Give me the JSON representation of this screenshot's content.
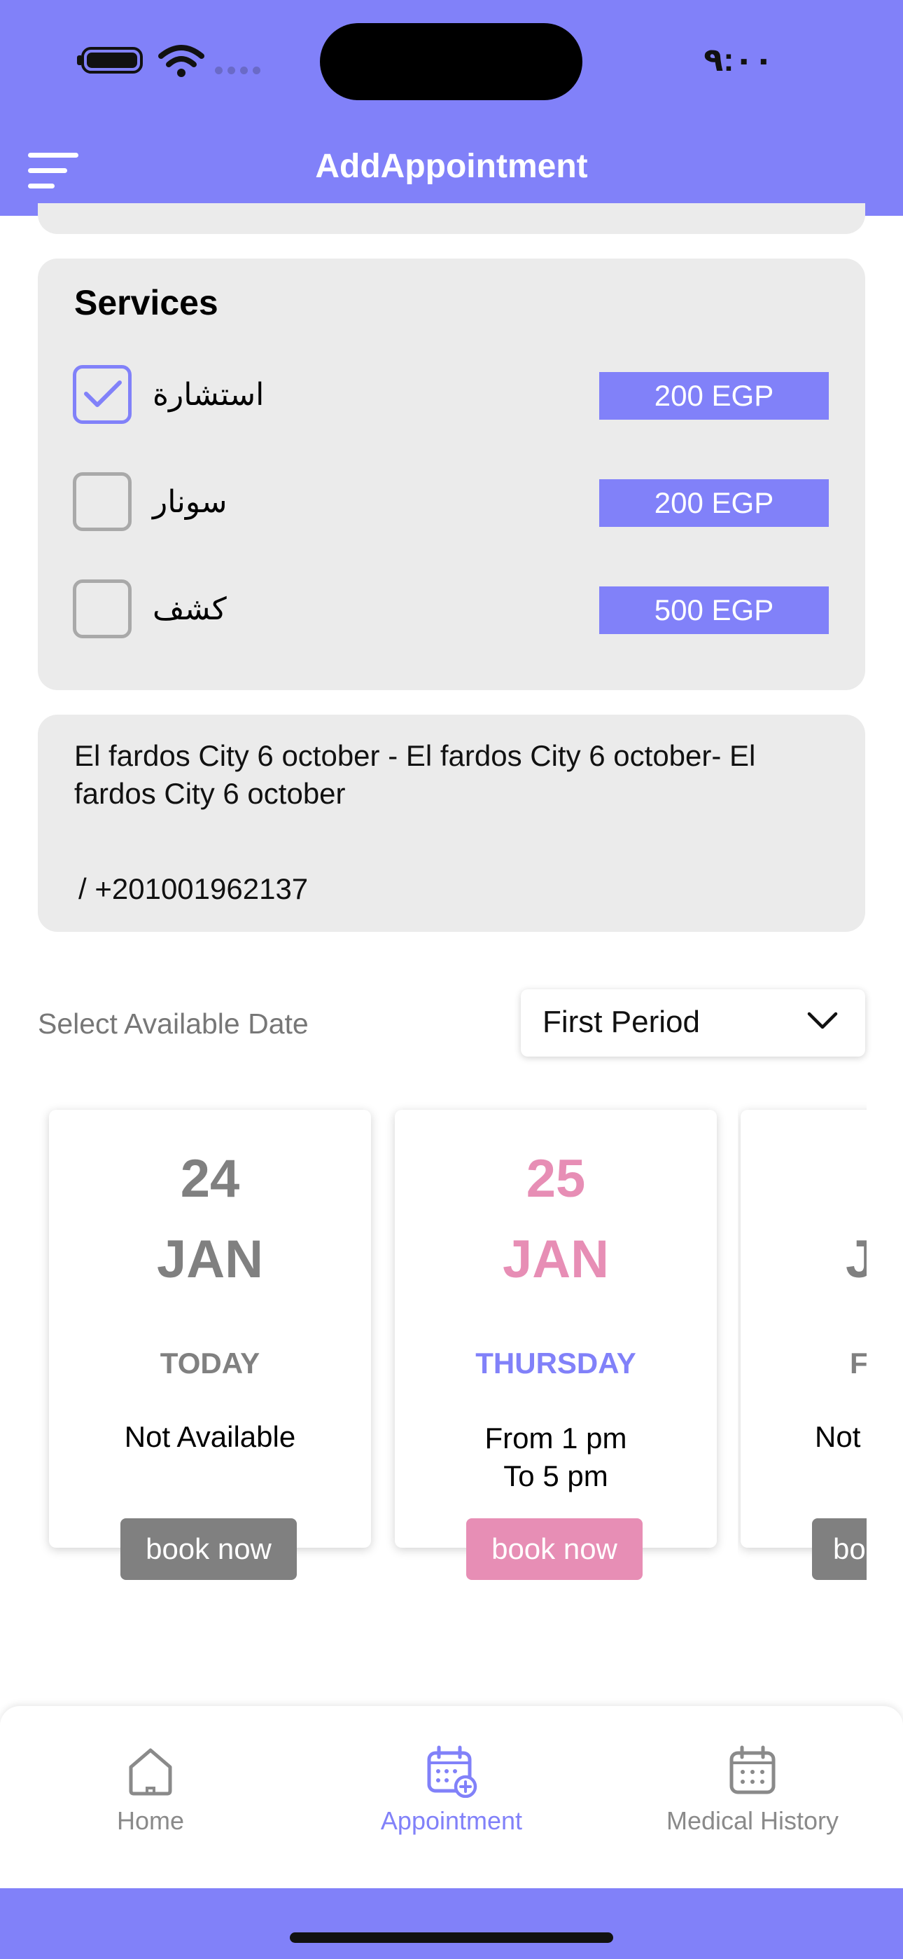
{
  "status_bar": {
    "time": "٩:٠٠"
  },
  "header": {
    "title": "AddAppointment"
  },
  "services": {
    "title": "Services",
    "items": [
      {
        "name": "استشارة",
        "price": "200 EGP",
        "checked": true
      },
      {
        "name": "سونار",
        "price": "200 EGP",
        "checked": false
      },
      {
        "name": "كشف",
        "price": "500 EGP",
        "checked": false
      }
    ]
  },
  "address": {
    "text": "El fardos City 6 october - El fardos City 6 october- El fardos City 6 october",
    "phone": "/ +201001962137"
  },
  "date_selection": {
    "label": "Select Available Date",
    "period": "First Period"
  },
  "days": [
    {
      "day": "24",
      "month": "JAN",
      "weekday": "TODAY",
      "availability": "Not Available",
      "book": "book now"
    },
    {
      "day": "25",
      "month": "JAN",
      "weekday": "THURSDAY",
      "availability_line1": "From 1 pm",
      "availability_line2": "To 5 pm",
      "book": "book now"
    },
    {
      "month_partial": "J",
      "weekday_partial": "F",
      "availability_partial": "Not",
      "book_partial": "bo"
    }
  ],
  "bottom_nav": {
    "items": [
      {
        "label": "Home",
        "icon": "home-icon",
        "active": false
      },
      {
        "label": "Appointment",
        "icon": "calendar-add-icon",
        "active": true
      },
      {
        "label": "Medical History",
        "icon": "calendar-icon",
        "active": false
      }
    ]
  },
  "colors": {
    "primary": "#8181f9",
    "accent_pink": "#e78eb5",
    "gray": "#808080",
    "card_bg": "#ebebeb"
  }
}
